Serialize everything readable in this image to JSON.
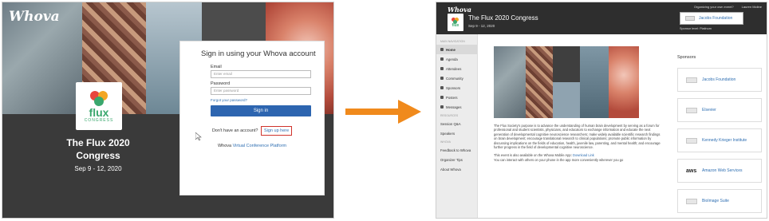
{
  "left_panel": {
    "brand": "Whova",
    "flux_logo": {
      "word": "flux",
      "sub": "CONGRESS"
    },
    "event_title": "The Flux 2020 Congress",
    "event_dates": "Sep 9 - 12, 2020",
    "login": {
      "title": "Sign in using your Whova account",
      "email_label": "Email",
      "email_placeholder": "Enter email",
      "password_label": "Password",
      "password_placeholder": "Enter password",
      "forgot_label": "Forgot your password?",
      "signin_label": "Sign in",
      "no_account_text": "Don't have an account?",
      "signup_label": "Sign up here",
      "platform_prefix": "Whova",
      "platform_link": "Virtual Conference Platform"
    }
  },
  "arrow": {
    "color": "#f08a1c"
  },
  "right_panel": {
    "brand": "Whova",
    "top_links": [
      "Organizing your own event?",
      "Lauren Moline"
    ],
    "flux_logo": {
      "word": "flux"
    },
    "event_title": "The Flux 2020 Congress",
    "event_dates": "Sep 9 - 12, 2020",
    "top_sponsor": {
      "name": "Jacobs Foundation",
      "level": "Sponsor level: Platinum"
    },
    "nav": {
      "main_section": "MAIN NAVIGATION",
      "main_items": [
        {
          "label": "Home",
          "icon": "home-icon",
          "active": true
        },
        {
          "label": "Agenda",
          "icon": "calendar-icon"
        },
        {
          "label": "Attendees",
          "icon": "people-icon"
        },
        {
          "label": "Community",
          "icon": "chat-icon"
        },
        {
          "label": "Sponsors",
          "icon": "sponsor-icon"
        },
        {
          "label": "Posters",
          "icon": "poster-icon"
        },
        {
          "label": "Messages",
          "icon": "message-icon"
        }
      ],
      "resources_section": "RESOURCES",
      "resource_items": [
        "Session Q&A",
        "Speakers"
      ],
      "whova_section": "WHOVA",
      "whova_items": [
        "Feedback to Whova",
        "Organizer Tips",
        "About Whova"
      ]
    },
    "description": {
      "paragraph1": "The Flux Society's purpose is to advance the understanding of human brain development by serving as a forum for professional and student scientists, physicians, and educators to exchange information and educate the next generation of developmental cognitive neuroscience researchers; make widely available scientific research findings on brain development; encourage translational research to clinical populations; promote public information by discussing implications on the fields of education, health, juvenile law, parenting, and mental health; and encourage further progress in the field of developmental cognitive neuroscience.",
      "app_line_prefix": "This event is also available on the Whova Mobile App:",
      "app_link": "Download Link",
      "interact_line": "You can interact with others on your phone in the app more conveniently wherever you go"
    },
    "sponsors_title": "Sponsors",
    "sponsors": [
      {
        "name": "Jacobs Foundation",
        "logo": "jacobs-logo"
      },
      {
        "name": "Elsevier",
        "logo": "elsevier-logo"
      },
      {
        "name": "Kennedy Krieger Institute",
        "logo": "kki-logo"
      },
      {
        "name": "Amazon Web Services",
        "logo": "aws"
      },
      {
        "name": "BioImage Suite",
        "logo": "bioimage-logo"
      }
    ]
  }
}
